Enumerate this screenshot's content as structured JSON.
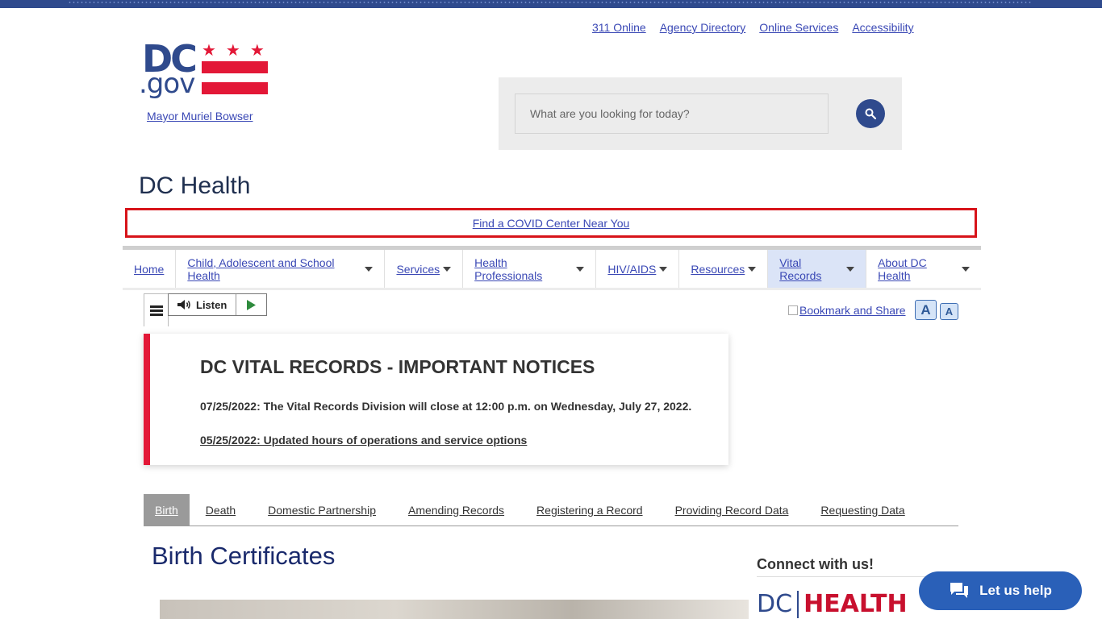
{
  "utility_nav": [
    "311 Online",
    "Agency Directory",
    "Online Services",
    "Accessibility"
  ],
  "logo": {
    "dc": "DC",
    "gov": ".gov",
    "stars": "★★★"
  },
  "mayor_link": "Mayor Muriel Bowser",
  "search": {
    "placeholder": "What are you looking for today?",
    "icon": "search-icon"
  },
  "agency_title": "DC Health",
  "covid_banner": "Find a COVID Center Near You",
  "main_nav": [
    {
      "label": "Home",
      "dropdown": false
    },
    {
      "label": "Child, Adolescent and School Health",
      "dropdown": true
    },
    {
      "label": "Services",
      "dropdown": true
    },
    {
      "label": "Health Professionals",
      "dropdown": true
    },
    {
      "label": "HIV/AIDS",
      "dropdown": true
    },
    {
      "label": "Resources",
      "dropdown": true
    },
    {
      "label": "Vital Records",
      "dropdown": true,
      "active": true
    },
    {
      "label": "About DC Health",
      "dropdown": true
    }
  ],
  "toolbar": {
    "listen_label": "Listen",
    "bookmark": "Bookmark and Share",
    "font_up": "A",
    "font_down": "A"
  },
  "notice": {
    "title": "DC VITAL RECORDS - IMPORTANT NOTICES",
    "line1": "07/25/2022: The Vital Records Division will close at 12:00 p.m. on Wednesday, July 27, 2022.",
    "line2": "05/25/2022: Updated hours of operations and service options"
  },
  "tabs": [
    {
      "label": "Birth",
      "active": true
    },
    {
      "label": "Death"
    },
    {
      "label": "Domestic Partnership"
    },
    {
      "label": "Amending Records"
    },
    {
      "label": "Registering a Record"
    },
    {
      "label": "Providing Record Data"
    },
    {
      "label": "Requesting Data"
    }
  ],
  "page_heading": "Birth Certificates",
  "sidebar": {
    "connect_title": "Connect with us!",
    "logo_dc": "DC",
    "logo_health": "HEALTH"
  },
  "chat": {
    "label": "Let us help",
    "icon": "chat-icon"
  },
  "colors": {
    "brand_blue": "#2f4a8d",
    "brand_red": "#e31837",
    "link": "#3a48b5",
    "chat": "#2a60b8"
  }
}
